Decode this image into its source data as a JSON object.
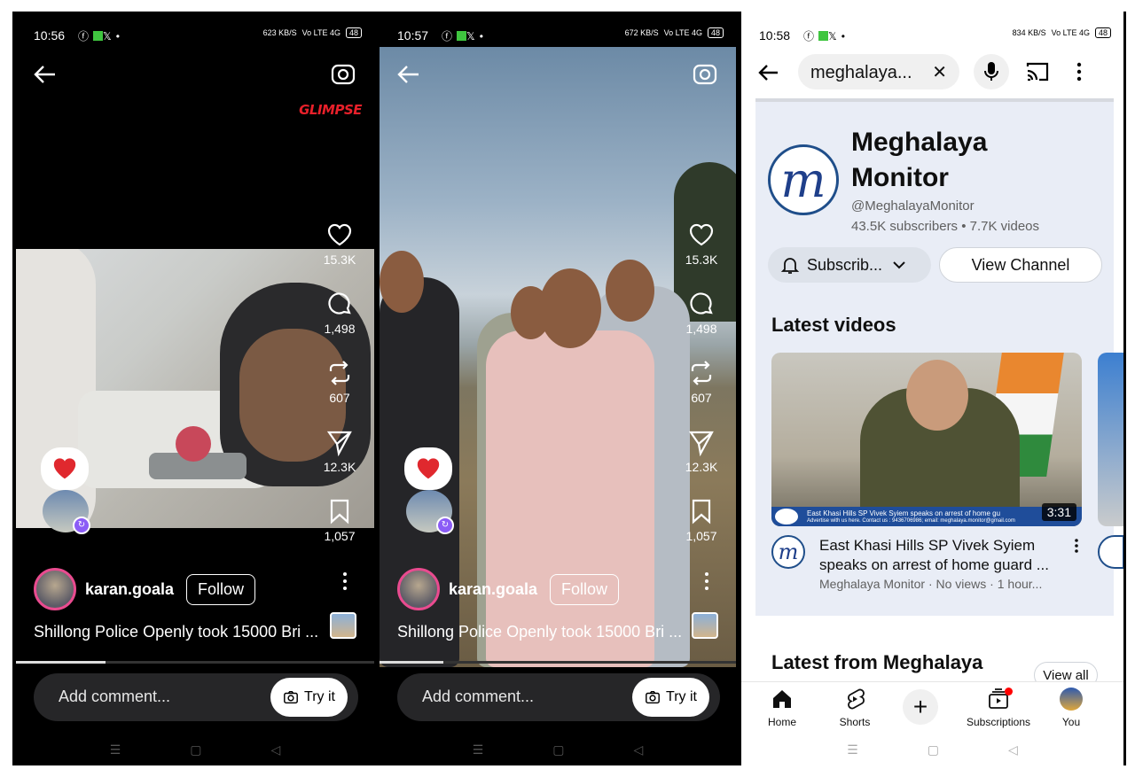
{
  "phones": [
    {
      "status": {
        "time": "10:56",
        "speed": "623 KB/S",
        "network": "Vo LTE 4G",
        "battery": "48"
      },
      "watermark": "GLIMPSE",
      "actions": {
        "likes": "15.3K",
        "comments": "1,498",
        "reposts": "607",
        "shares": "12.3K",
        "saves": "1,057"
      },
      "username": "karan.goala",
      "follow_label": "Follow",
      "caption": "Shillong Police Openly took 15000 Bri ...",
      "comment_placeholder": "Add comment...",
      "try_it_label": "Try it",
      "progress": 0.25
    },
    {
      "status": {
        "time": "10:57",
        "speed": "672 KB/S",
        "network": "Vo LTE 4G",
        "battery": "48"
      },
      "actions": {
        "likes": "15.3K",
        "comments": "1,498",
        "reposts": "607",
        "shares": "12.3K",
        "saves": "1,057"
      },
      "username": "karan.goala",
      "follow_label": "Follow",
      "caption": "Shillong Police Openly took 15000 Bri ...",
      "comment_placeholder": "Add comment...",
      "try_it_label": "Try it",
      "progress": 0.18
    }
  ],
  "youtube": {
    "status": {
      "time": "10:58",
      "speed": "834 KB/S",
      "network": "Vo LTE 4G",
      "battery": "48"
    },
    "search_query": "meghalaya...",
    "channel": {
      "name": "Meghalaya Monitor",
      "handle": "@MeghalayaMonitor",
      "stats": "43.5K subscribers • 7.7K videos",
      "subscribe_label": "Subscrib...",
      "view_channel_label": "View Channel"
    },
    "latest_videos_heading": "Latest videos",
    "video": {
      "title": "East Khasi Hills SP Vivek Syiem speaks on arrest of home guard ...",
      "meta": "Meghalaya Monitor · No views · 1 hour...",
      "duration": "3:31",
      "lower_third": "East Khasi Hills SP Vivek Syiem speaks on arrest of home gu",
      "lower_third_sub": "Advertise with us here. Contact us : 9436706986; email: meghalaya.monitor@gmail.com"
    },
    "latest_from_heading": "Latest from Meghalaya Monitor",
    "view_all_label": "View all",
    "nav": {
      "home": "Home",
      "shorts": "Shorts",
      "subscriptions": "Subscriptions",
      "you": "You"
    }
  },
  "colors": {
    "follow_ring": "#e94b8f",
    "yt_red": "#ff0000",
    "panel": "#e9edf6"
  }
}
